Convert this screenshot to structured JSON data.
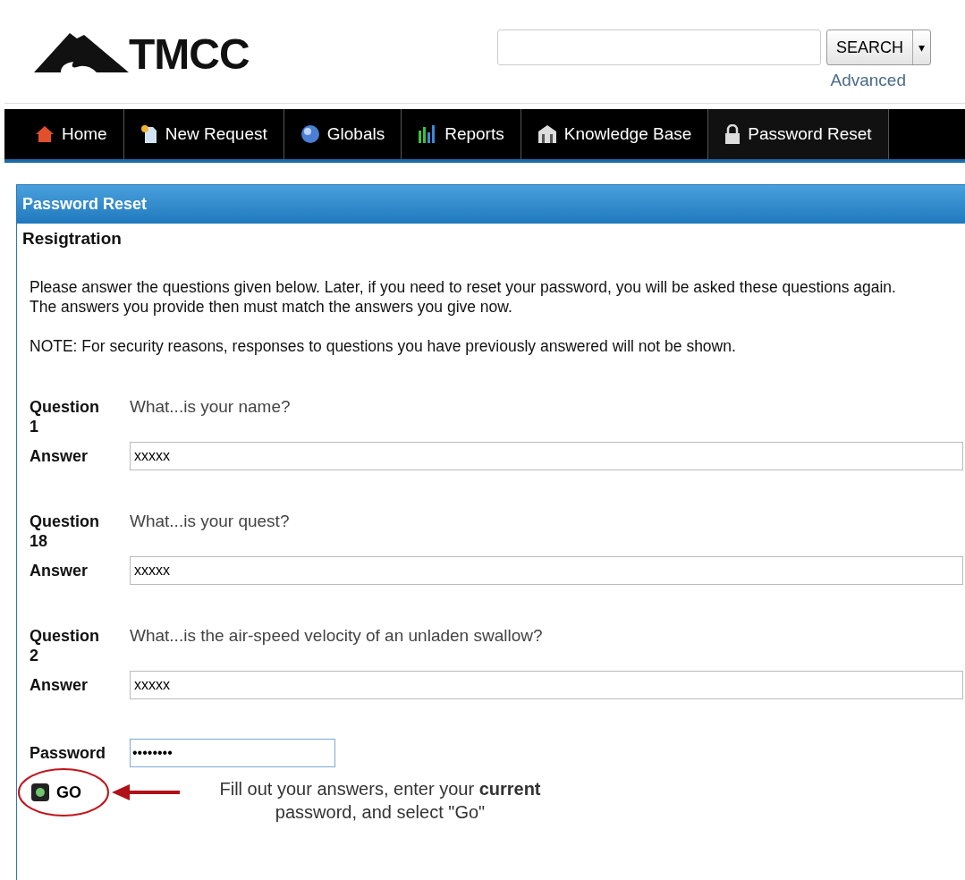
{
  "header": {
    "logo": "TMCC",
    "search": {
      "button": "SEARCH",
      "caret": "▾",
      "advanced": "Advanced"
    }
  },
  "nav": [
    {
      "label": "Home",
      "selected": false
    },
    {
      "label": "New Request",
      "selected": false
    },
    {
      "label": "Globals",
      "selected": false
    },
    {
      "label": "Reports",
      "selected": false
    },
    {
      "label": "Knowledge Base",
      "selected": false
    },
    {
      "label": "Password Reset",
      "selected": true
    }
  ],
  "panel": {
    "title": "Password Reset",
    "subtitle": "Resigtration",
    "intro": "Please answer the questions given below. Later, if you need to reset your password, you will be asked these questions again. The answers you provide then must match the answers you give now.",
    "note": "NOTE: For security reasons, responses to questions you have previously answered will not be shown.",
    "questions": [
      {
        "label": "Question 1",
        "text": "What...is your name?",
        "answer_label": "Answer",
        "answer": "xxxxx"
      },
      {
        "label": "Question 18",
        "text": "What...is your quest?",
        "answer_label": "Answer",
        "answer": "xxxxx"
      },
      {
        "label": "Question 2",
        "text": "What...is the air-speed velocity of an unladen swallow?",
        "answer_label": "Answer",
        "answer": "xxxxx"
      }
    ],
    "password_label": "Password",
    "password": "••••••••",
    "go": "GO"
  },
  "annotation": "Fill out your answers, enter your **current** password, and select \"Go\""
}
